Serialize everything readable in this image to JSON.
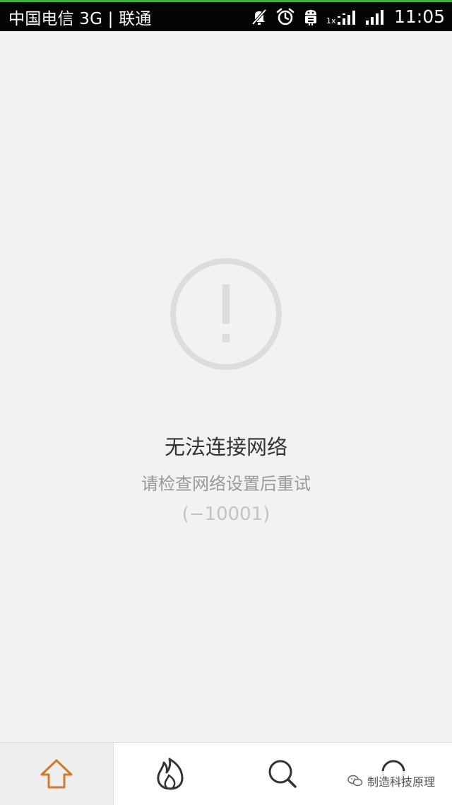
{
  "status_bar": {
    "carrier": "中国电信 3G | 联通",
    "network_label": "1x",
    "time": "11:05",
    "icons": [
      "mute-icon",
      "alarm-icon",
      "android-debug-icon",
      "signal-icon",
      "signal-icon"
    ],
    "accent": "#3cb043"
  },
  "error": {
    "icon": "alert-circle-icon",
    "title": "无法连接网络",
    "subtitle": "请检查网络设置后重试",
    "code": "(−10001)"
  },
  "tab_bar": {
    "active_color": "#d07a2a",
    "tabs": [
      {
        "icon": "home-icon",
        "active": true
      },
      {
        "icon": "flame-icon",
        "active": false
      },
      {
        "icon": "search-icon",
        "active": false
      },
      {
        "icon": "search-icon",
        "active": false
      }
    ]
  },
  "watermark": {
    "text": "制造科技原理",
    "icon": "wechat-icon"
  }
}
